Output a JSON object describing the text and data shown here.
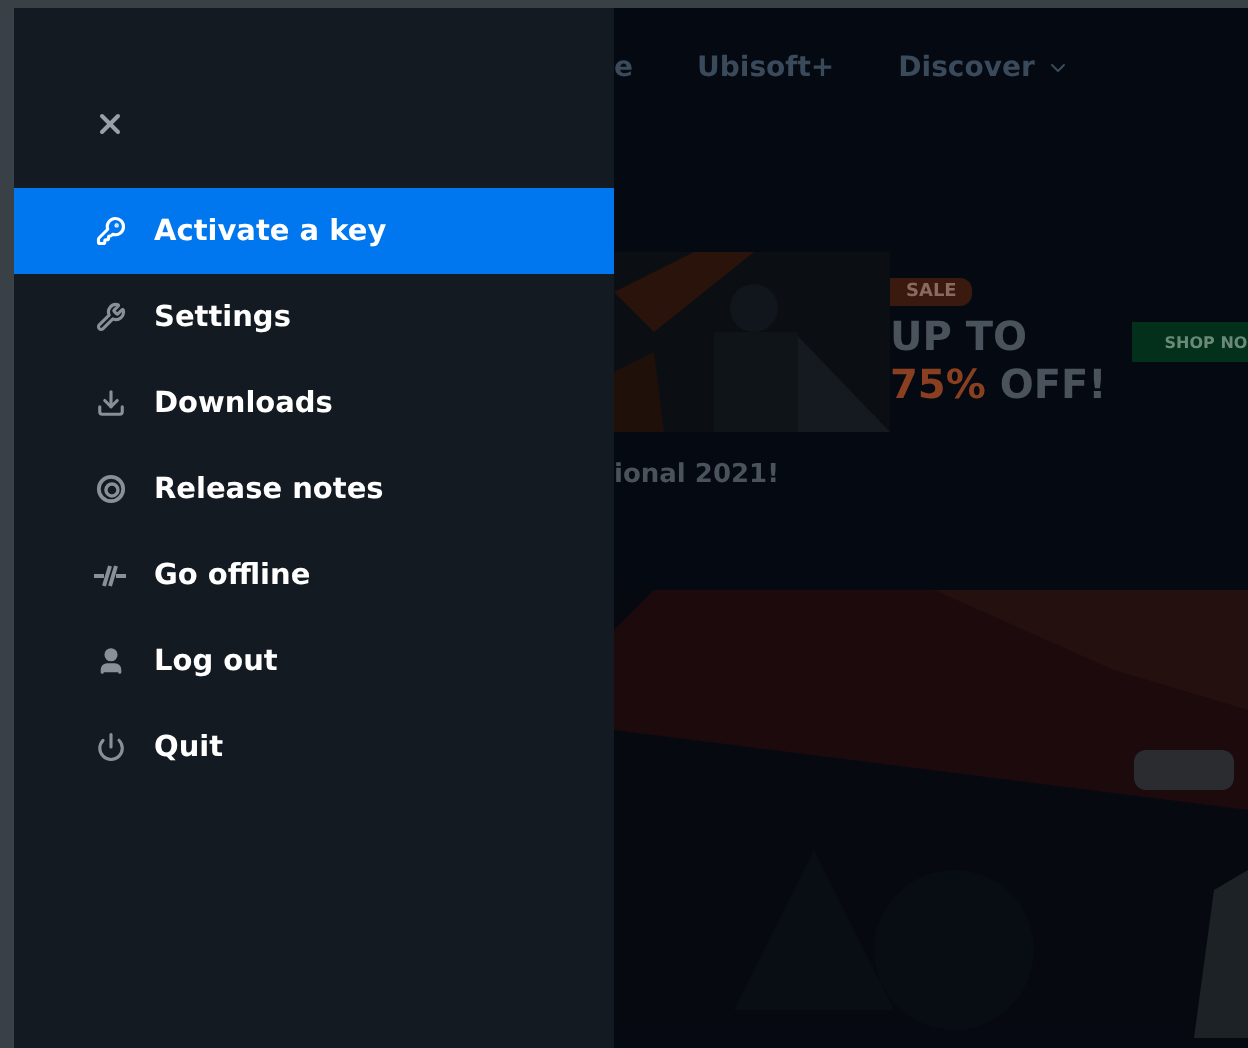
{
  "background": {
    "nav": [
      "e",
      "Ubisoft+",
      "Discover"
    ],
    "banner": {
      "badge": "SALE",
      "line_1": "UP TO",
      "accent": "75%",
      "line_2": "OFF!",
      "button": "SHOP NO"
    },
    "heading": "ional 2021!"
  },
  "menu": {
    "items": [
      {
        "label": "Activate a key",
        "selected": true
      },
      {
        "label": "Settings",
        "selected": false
      },
      {
        "label": "Downloads",
        "selected": false
      },
      {
        "label": "Release notes",
        "selected": false
      },
      {
        "label": "Go offline",
        "selected": false
      },
      {
        "label": "Log out",
        "selected": false
      },
      {
        "label": "Quit",
        "selected": false
      }
    ]
  }
}
